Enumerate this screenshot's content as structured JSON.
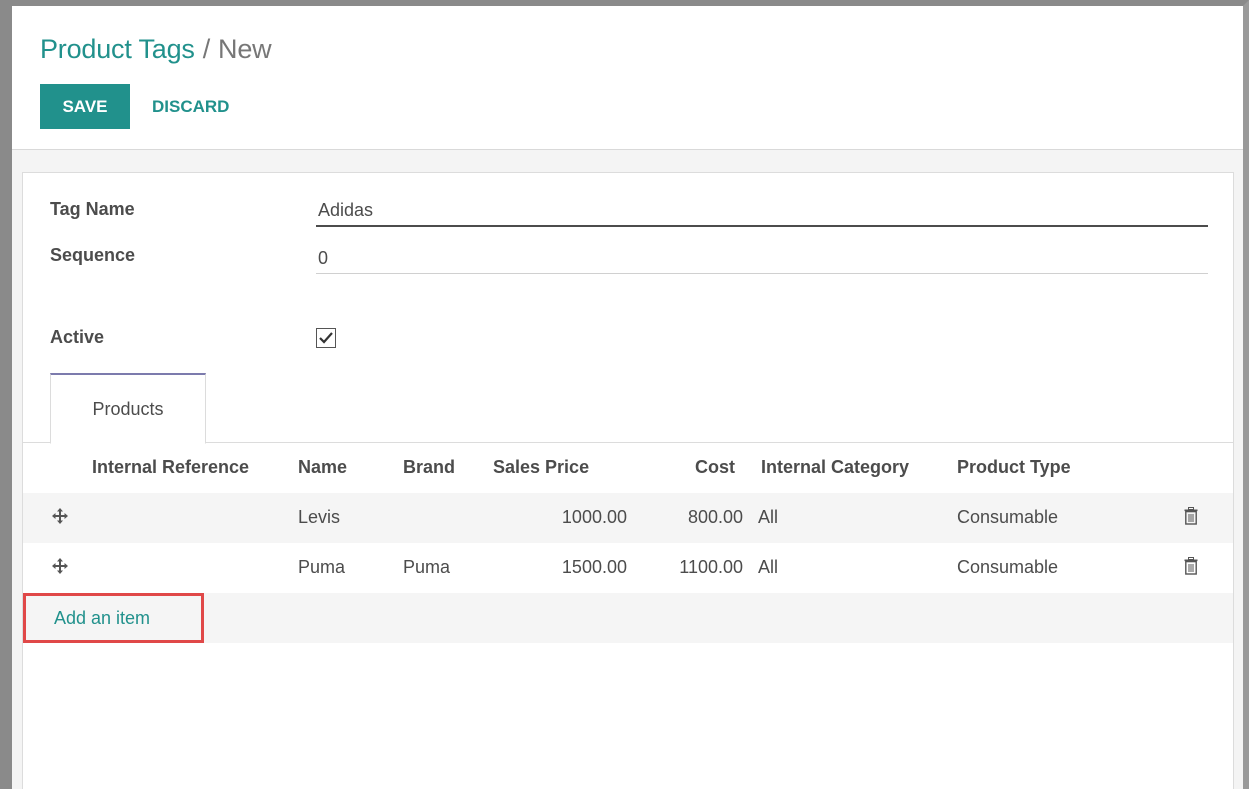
{
  "breadcrumb": {
    "parent": "Product Tags",
    "separator": "/",
    "current": "New"
  },
  "toolbar": {
    "save_label": "SAVE",
    "discard_label": "DISCARD"
  },
  "form": {
    "tag_name_label": "Tag Name",
    "tag_name_value": "Adidas",
    "sequence_label": "Sequence",
    "sequence_value": "0",
    "active_label": "Active",
    "active_checked": true
  },
  "tabs": [
    {
      "label": "Products",
      "active": true
    }
  ],
  "table": {
    "columns": [
      "Internal Reference",
      "Name",
      "Brand",
      "Sales Price",
      "Cost",
      "Internal Category",
      "Product Type"
    ],
    "rows": [
      {
        "internal_reference": "",
        "name": "Levis",
        "brand": "",
        "sales_price": "1000.00",
        "cost": "800.00",
        "internal_category": "All",
        "product_type": "Consumable"
      },
      {
        "internal_reference": "",
        "name": "Puma",
        "brand": "Puma",
        "sales_price": "1500.00",
        "cost": "1100.00",
        "internal_category": "All",
        "product_type": "Consumable"
      }
    ],
    "add_item_label": "Add an item"
  },
  "colors": {
    "accent": "#21918c",
    "highlight_box": "#e04848",
    "tab_top": "#7c7bad"
  },
  "icons": {
    "row_handle": "move-arrows-icon",
    "row_delete": "trash-icon",
    "checkbox_mark": "checkmark-icon"
  }
}
